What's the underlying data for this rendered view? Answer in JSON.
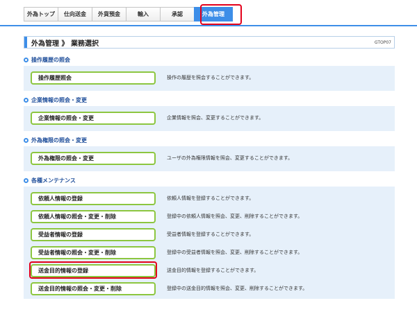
{
  "tabs": [
    "外為トップ",
    "仕向送金",
    "外貨預金",
    "輸入",
    "承認",
    "外為管理"
  ],
  "page": {
    "title": "外為管理 》 業務選択",
    "code": "GTOP07"
  },
  "sections": [
    {
      "heading": "操作履歴の照会",
      "items": [
        {
          "label": "操作履歴照会",
          "desc": "操作の履歴を照会することができます。"
        }
      ]
    },
    {
      "heading": "企業情報の照会・変更",
      "items": [
        {
          "label": "企業情報の照会・変更",
          "desc": "企業情報を照会、変更することができます。"
        }
      ]
    },
    {
      "heading": "外為権限の照会・変更",
      "items": [
        {
          "label": "外為権限の照会・変更",
          "desc": "ユーザの外為権限情報を照会、変更することができます。"
        }
      ]
    },
    {
      "heading": "各種メンテナンス",
      "items": [
        {
          "label": "依頼人情報の登録",
          "desc": "依頼人情報を登録することができます。"
        },
        {
          "label": "依頼人情報の照会・変更・削除",
          "desc": "登録中の依頼人情報を照会、変更、削除することができます。"
        },
        {
          "label": "受益者情報の登録",
          "desc": "受益者情報を登録することができます。"
        },
        {
          "label": "受益者情報の照会・変更・削除",
          "desc": "登録中の受益者情報を照会、変更、削除することができます。"
        },
        {
          "label": "送金目的情報の登録",
          "desc": "送金目的情報を登録することができます。"
        },
        {
          "label": "送金目的情報の照会・変更・削除",
          "desc": "登録中の送金目的情報を照会、変更、削除することができます。"
        }
      ]
    }
  ],
  "colors": {
    "accent": "#3d8ee8",
    "highlight": "#e3001b",
    "button_border": "#8cc63f",
    "panel": "#e6f0fa"
  }
}
